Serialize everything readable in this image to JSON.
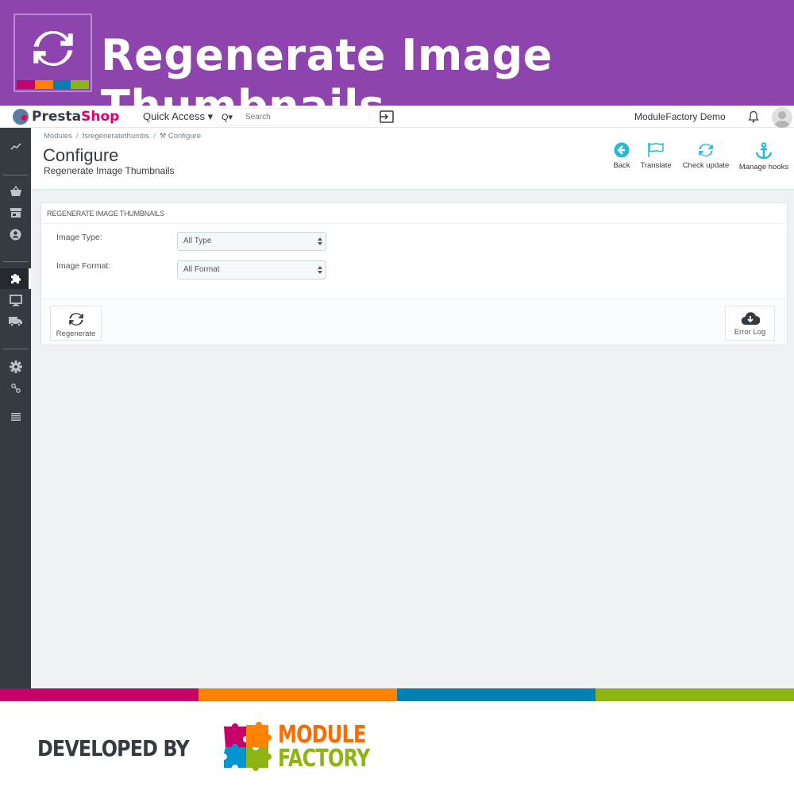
{
  "banner": {
    "title": "Regenerate Image Thumbnails",
    "icon": "refresh-icon",
    "stripe_colors": [
      "#c7006a",
      "#ff8200",
      "#0080b3",
      "#8cb511"
    ],
    "background": "#8e44ad"
  },
  "topbar": {
    "brand_part1": "Presta",
    "brand_part2": "Shop",
    "quick_access": "Quick Access ▾",
    "search_placeholder": "Search",
    "search_icon_label": "Q▾",
    "shop_name": "ModuleFactory Demo"
  },
  "sidebar": {
    "items": [
      {
        "icon": "stats-icon",
        "active": false
      },
      {
        "icon": "orders-basket-icon",
        "active": false
      },
      {
        "icon": "catalog-store-icon",
        "active": false
      },
      {
        "icon": "customers-icon",
        "active": false
      },
      {
        "icon": "modules-puzzle-icon",
        "active": true
      },
      {
        "icon": "design-monitor-icon",
        "active": false
      },
      {
        "icon": "shipping-truck-icon",
        "active": false
      },
      {
        "icon": "settings-gear-icon",
        "active": false
      },
      {
        "icon": "advanced-link-icon",
        "active": false
      },
      {
        "icon": "menu-collapse-icon",
        "active": false
      }
    ]
  },
  "page_header": {
    "breadcrumb": [
      "Modules",
      "fsregeneratethumbs",
      "Configure"
    ],
    "title": "Configure",
    "subtitle": "Regenerate Image Thumbnails",
    "toolbar": [
      {
        "label": "Back",
        "icon": "back-arrow-icon"
      },
      {
        "label": "Translate",
        "icon": "flag-icon"
      },
      {
        "label": "Check update",
        "icon": "refresh-icon"
      },
      {
        "label": "Manage hooks",
        "icon": "anchor-icon"
      }
    ],
    "accent": "#25b9d7"
  },
  "panel": {
    "heading": "REGENERATE IMAGE THUMBNAILS",
    "fields": [
      {
        "label": "Image Type:",
        "value": "All Type"
      },
      {
        "label": "Image Format:",
        "value": "All Format"
      }
    ],
    "buttons": {
      "regenerate": "Regenerate",
      "error_log": "Error Log"
    }
  },
  "footer": {
    "developed_by": "DEVELOPED BY",
    "brand_line1": "MODULE",
    "brand_line2": "FACTORY",
    "colors": [
      "#c7006a",
      "#ff8200",
      "#0080b3",
      "#8cb511"
    ]
  }
}
